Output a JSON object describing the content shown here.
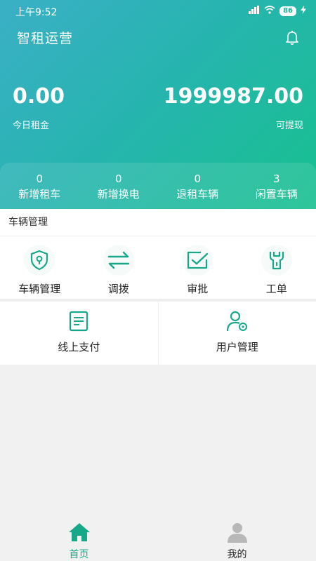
{
  "status_bar": {
    "time": "上午9:52",
    "battery": "86"
  },
  "app": {
    "title": "智租运营"
  },
  "summary": {
    "today_rent_value": "0.00",
    "today_rent_label": "今日租金",
    "withdrawable_value": "1999987.00",
    "withdrawable_label": "可提现"
  },
  "stats": [
    {
      "value": "0",
      "label": "新增租车"
    },
    {
      "value": "0",
      "label": "新增换电"
    },
    {
      "value": "0",
      "label": "退租车辆"
    },
    {
      "value": "3",
      "label": "闲置车辆"
    }
  ],
  "vehicle_section": {
    "title": "车辆管理",
    "items": [
      {
        "label": "车辆管理",
        "icon": "shield-icon"
      },
      {
        "label": "调拨",
        "icon": "transfer-arrows-icon"
      },
      {
        "label": "审批",
        "icon": "approval-check-icon"
      },
      {
        "label": "工单",
        "icon": "wrench-icon"
      }
    ]
  },
  "extra_section": {
    "items": [
      {
        "label": "线上支付",
        "icon": "document-icon"
      },
      {
        "label": "用户管理",
        "icon": "user-settings-icon"
      }
    ]
  },
  "bottom_nav": [
    {
      "label": "首页",
      "icon": "home-icon",
      "active": true
    },
    {
      "label": "我的",
      "icon": "profile-icon",
      "active": false
    }
  ],
  "colors": {
    "accent": "#17a88a",
    "header_start": "#3bb0c6",
    "header_end": "#17c08f"
  }
}
